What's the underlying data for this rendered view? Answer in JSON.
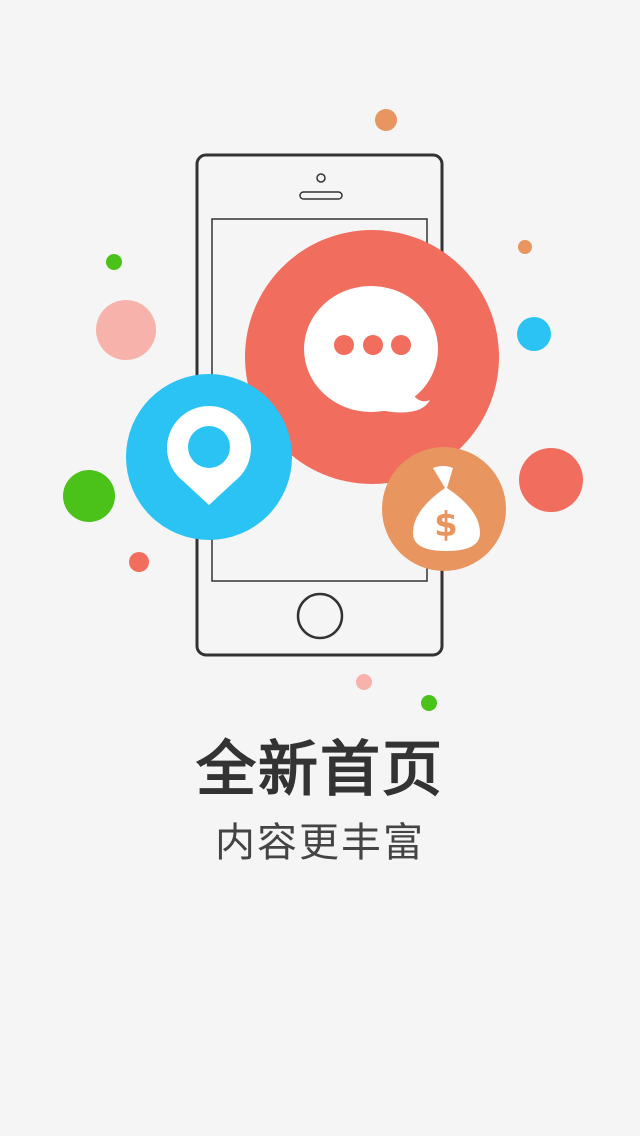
{
  "onboarding": {
    "title": "全新首页",
    "subtitle": "内容更丰富"
  },
  "illustration": {
    "phone": "smartphone-outline",
    "icons": [
      "chat-bubble-icon",
      "location-pin-icon",
      "money-bag-icon"
    ],
    "money_symbol": "$"
  },
  "colors": {
    "background": "#f5f5f5",
    "coral": "#f16d5e",
    "blue": "#2ac3f3",
    "orange": "#e8955f",
    "green": "#4bc21a",
    "pink": "#f8b2ac",
    "outline": "#333333"
  }
}
